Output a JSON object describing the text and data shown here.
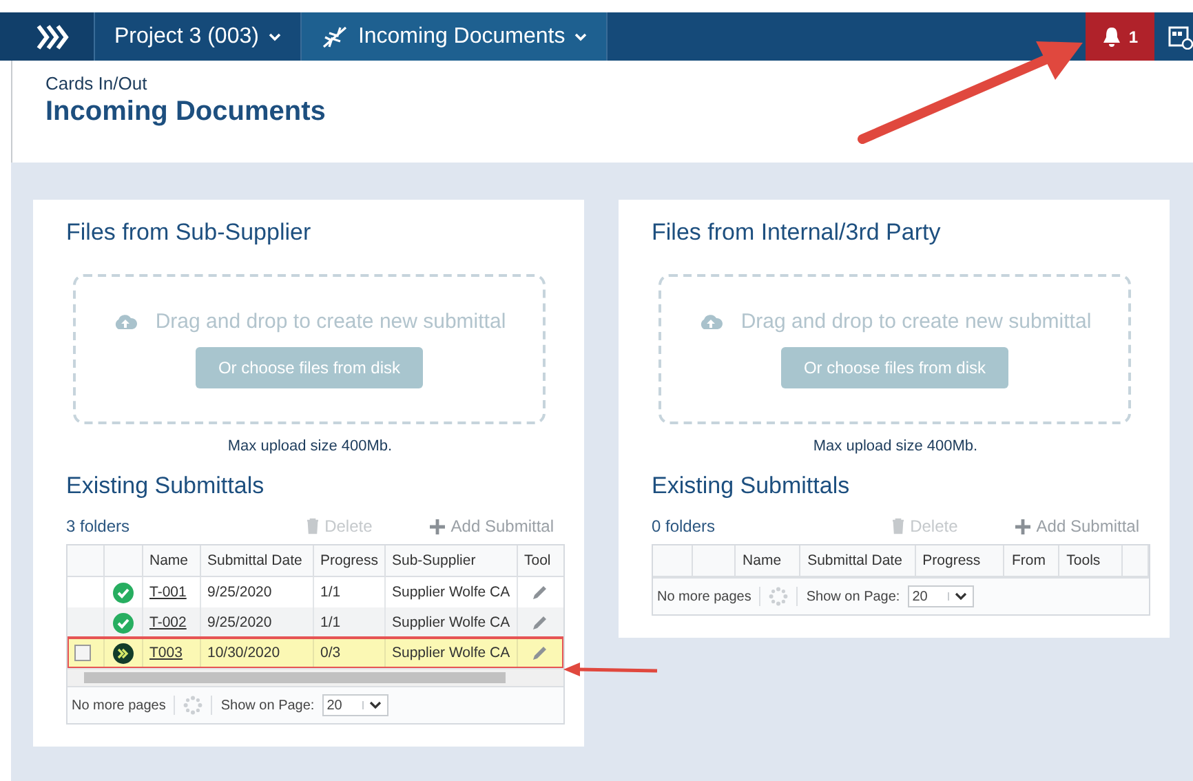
{
  "nav": {
    "breadcrumbs": [
      {
        "kind": "home"
      },
      {
        "kind": "project",
        "label": "Project 3 (003)"
      },
      {
        "kind": "module",
        "label": "Incoming Documents"
      }
    ],
    "notifications": {
      "count": "1"
    }
  },
  "header": {
    "section": "Cards In/Out",
    "title": "Incoming Documents"
  },
  "panels": [
    {
      "title": "Files from Sub-Supplier",
      "dropzone": {
        "text": "Drag and drop to create new submittal",
        "button": "Or choose files from disk"
      },
      "max_upload": "Max upload size 400Mb.",
      "submittals": {
        "title": "Existing Submittals",
        "count": "3 folders",
        "delete": "Delete",
        "add": "Add Submittal",
        "columns": [
          "",
          "",
          "Name",
          "Submittal Date",
          "Progress",
          "Sub-Supplier",
          "Tool"
        ],
        "rows": [
          {
            "complete": true,
            "name": "T-001",
            "date": "9/25/2020",
            "progress": "1/1",
            "party": "Supplier Wolfe CA",
            "selected": false
          },
          {
            "complete": true,
            "name": "T-002",
            "date": "9/25/2020",
            "progress": "1/1",
            "party": "Supplier Wolfe CA",
            "selected": false
          },
          {
            "complete": false,
            "name": "T003",
            "date": "10/30/2020",
            "progress": "0/3",
            "party": "Supplier Wolfe CA",
            "selected": true
          }
        ],
        "pager": {
          "text": "No more pages",
          "show_label": "Show on Page:",
          "page_size": "20"
        }
      }
    },
    {
      "title": "Files from Internal/3rd Party",
      "dropzone": {
        "text": "Drag and drop to create new submittal",
        "button": "Or choose files from disk"
      },
      "max_upload": "Max upload size 400Mb.",
      "submittals": {
        "title": "Existing Submittals",
        "count": "0 folders",
        "delete": "Delete",
        "add": "Add Submittal",
        "columns": [
          "",
          "",
          "Name",
          "Submittal Date",
          "Progress",
          "From",
          "Tools",
          ""
        ],
        "pager": {
          "text": "No more pages",
          "show_label": "Show on Page:",
          "page_size": "20"
        }
      }
    }
  ]
}
